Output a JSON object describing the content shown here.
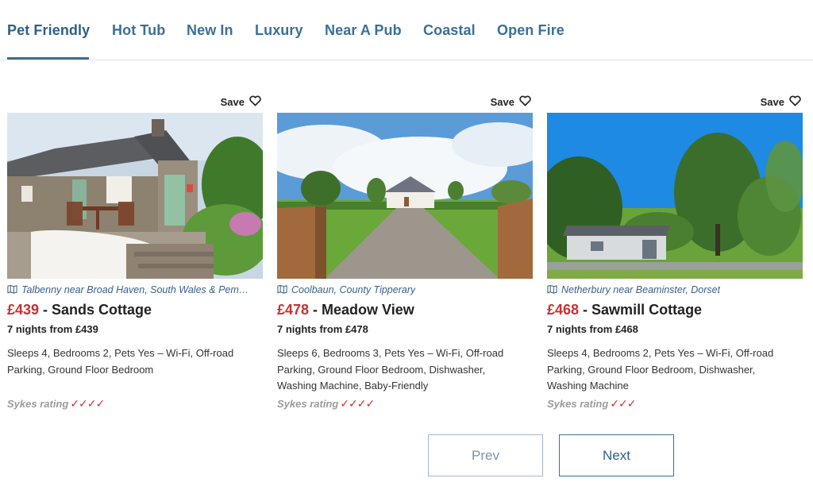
{
  "tabs": [
    {
      "label": "Pet Friendly",
      "active": true
    },
    {
      "label": "Hot Tub"
    },
    {
      "label": "New In"
    },
    {
      "label": "Luxury"
    },
    {
      "label": "Near A Pub"
    },
    {
      "label": "Coastal"
    },
    {
      "label": "Open Fire"
    }
  ],
  "cards": [
    {
      "save_label": "Save",
      "location": "Talbenny near Broad Haven, South Wales & Pem…",
      "price": "£439",
      "name": " - Sands Cottage",
      "nights": "7 nights from £439",
      "description": "Sleeps 4, Bedrooms 2, Pets Yes – Wi-Fi, Off-road Parking, Ground Floor Bedroom",
      "rating_label": "Sykes rating",
      "rating_ticks": "✓✓✓✓",
      "photo_icon": "stone-cottage-courtyard-photo"
    },
    {
      "save_label": "Save",
      "location": "Coolbaun, County Tipperary",
      "price": "£478",
      "name": " - Meadow View",
      "nights": "7 nights from £478",
      "description": "Sleeps 6, Bedrooms 3, Pets Yes – Wi-Fi, Off-road Parking, Ground Floor Bedroom, Dishwasher, Washing Machine, Baby-Friendly",
      "rating_label": "Sykes rating",
      "rating_ticks": "✓✓✓✓",
      "photo_icon": "country-house-driveway-photo"
    },
    {
      "save_label": "Save",
      "location": "Netherbury near Beaminster, Dorset",
      "price": "£468",
      "name": " - Sawmill Cottage",
      "nights": "7 nights from £468",
      "description": "Sleeps 4, Bedrooms 2, Pets Yes – Wi-Fi, Off-road Parking, Ground Floor Bedroom, Dishwasher, Washing Machine",
      "rating_label": "Sykes rating",
      "rating_ticks": "✓✓✓",
      "photo_icon": "cottage-among-trees-photo"
    }
  ],
  "pager": {
    "prev_label": "Prev",
    "next_label": "Next"
  },
  "colors": {
    "tab_text": "#3a6f99",
    "price": "#c8312f",
    "location": "#3a5f86",
    "button_border": "#3a6f99"
  }
}
